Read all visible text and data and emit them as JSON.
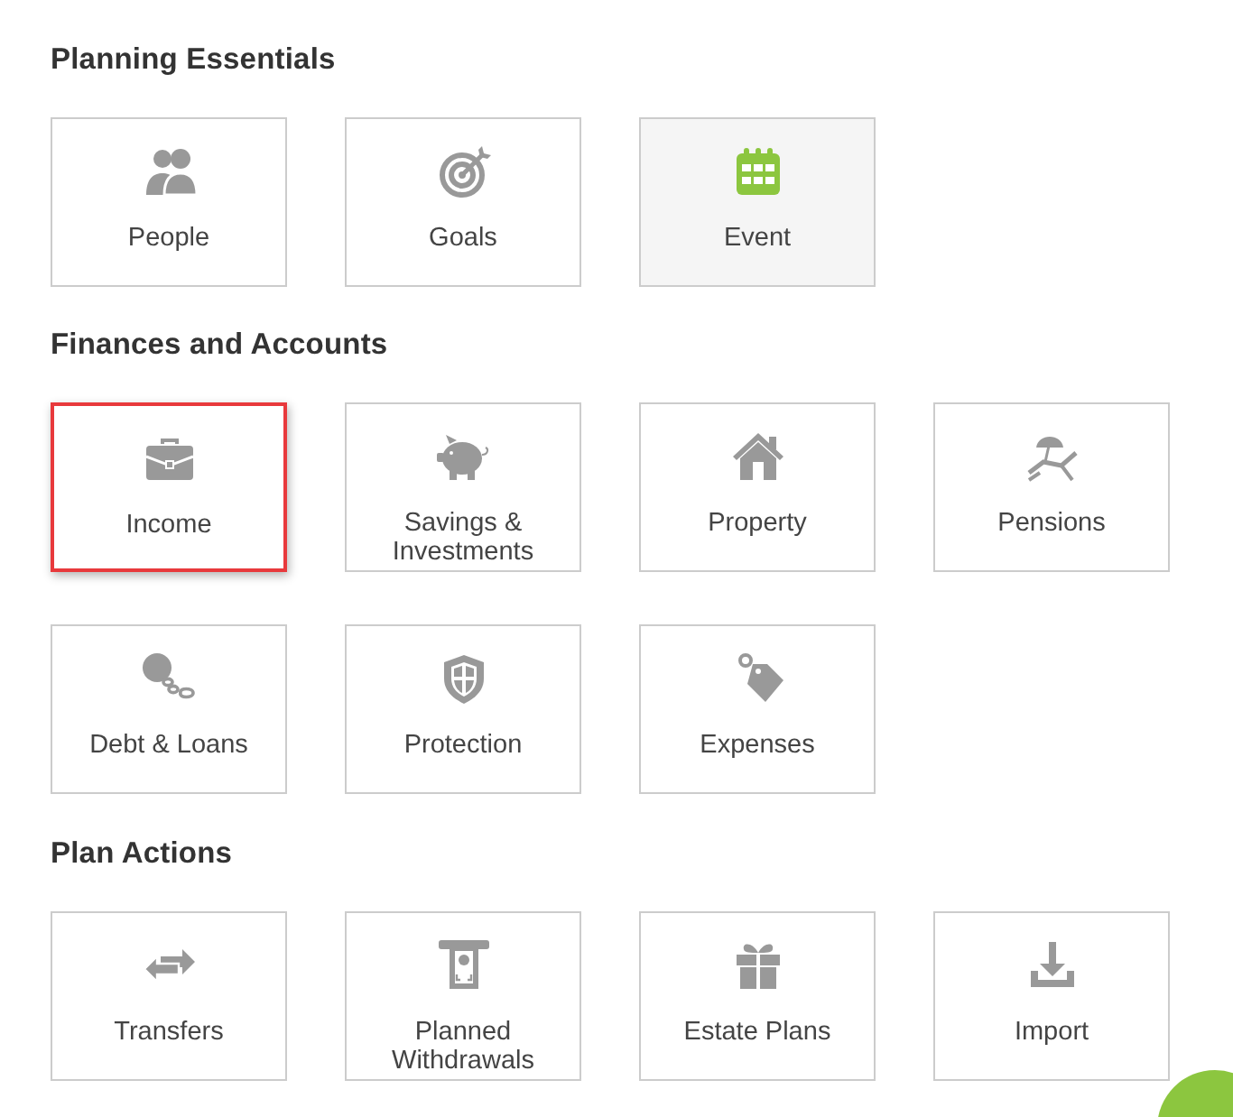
{
  "sections": [
    {
      "title": "Planning Essentials",
      "tiles": [
        {
          "label": "People",
          "selected": false,
          "highlighted": false
        },
        {
          "label": "Goals",
          "selected": false,
          "highlighted": false
        },
        {
          "label": "Event",
          "selected": false,
          "highlighted": true
        }
      ]
    },
    {
      "title": "Finances and Accounts",
      "tiles": [
        {
          "label": "Income",
          "selected": true,
          "highlighted": false
        },
        {
          "label": "Savings & Investments",
          "selected": false,
          "highlighted": false
        },
        {
          "label": "Property",
          "selected": false,
          "highlighted": false
        },
        {
          "label": "Pensions",
          "selected": false,
          "highlighted": false
        },
        {
          "label": "Debt & Loans",
          "selected": false,
          "highlighted": false
        },
        {
          "label": "Protection",
          "selected": false,
          "highlighted": false
        },
        {
          "label": "Expenses",
          "selected": false,
          "highlighted": false
        }
      ]
    },
    {
      "title": "Plan Actions",
      "tiles": [
        {
          "label": "Transfers",
          "selected": false,
          "highlighted": false
        },
        {
          "label": "Planned Withdrawals",
          "selected": false,
          "highlighted": false
        },
        {
          "label": "Estate Plans",
          "selected": false,
          "highlighted": false
        },
        {
          "label": "Import",
          "selected": false,
          "highlighted": false
        }
      ]
    }
  ]
}
